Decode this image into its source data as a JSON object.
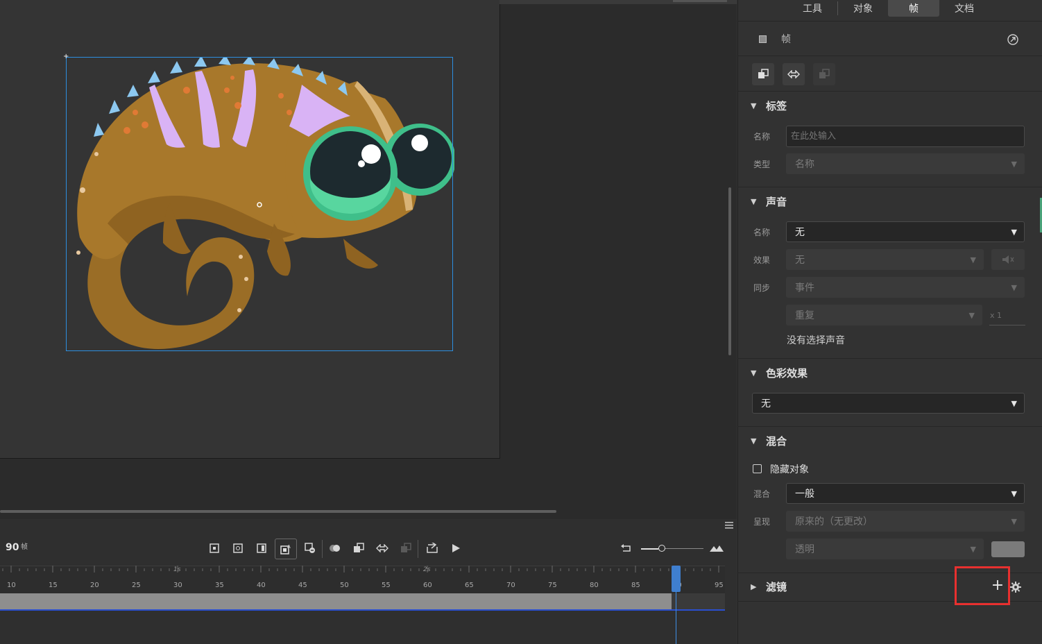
{
  "panel": {
    "tabs": [
      {
        "label": "工具",
        "active": false
      },
      {
        "label": "对象",
        "active": false
      },
      {
        "label": "帧",
        "active": true
      },
      {
        "label": "文档",
        "active": false
      }
    ],
    "header": {
      "title": "帧"
    },
    "label_section": {
      "title": "标签",
      "name_label": "名称",
      "name_placeholder": "在此处输入",
      "type_label": "类型",
      "type_value": "名称"
    },
    "sound_section": {
      "title": "声音",
      "name_label": "名称",
      "name_value": "无",
      "effect_label": "效果",
      "effect_value": "无",
      "sync_label": "同步",
      "sync_value": "事件",
      "repeat_value": "重复",
      "repeat_count": "x 1",
      "no_sound_text": "没有选择声音"
    },
    "color_section": {
      "title": "色彩效果",
      "value": "无"
    },
    "blend_section": {
      "title": "混合",
      "hide_object_label": "隐藏对象",
      "hide_object_checked": false,
      "blend_label": "混合",
      "blend_value": "一般",
      "render_label": "呈现",
      "render_value": "原来的（无更改）",
      "transparency_value": "透明"
    },
    "filter_section": {
      "title": "滤镜",
      "add_symbol": "+"
    }
  },
  "timeline": {
    "frame_count": "90",
    "frame_unit": "帧",
    "second_labels": [
      "1s",
      "2s"
    ],
    "tick_labels": [
      "10",
      "15",
      "20",
      "25",
      "30",
      "35",
      "40",
      "45",
      "50",
      "55",
      "60",
      "65",
      "70",
      "75",
      "80",
      "85",
      "90",
      "95"
    ],
    "current_frame": 90
  },
  "colors": {
    "selection": "#2d8fe0",
    "playhead": "#3f7fcf",
    "highlight_box": "#e8302f",
    "chameleon_body": "#a8782b",
    "chameleon_stripes": "#d9b3f5",
    "chameleon_spikes": "#8cc8f0",
    "chameleon_eye": "#3fbf8a"
  }
}
